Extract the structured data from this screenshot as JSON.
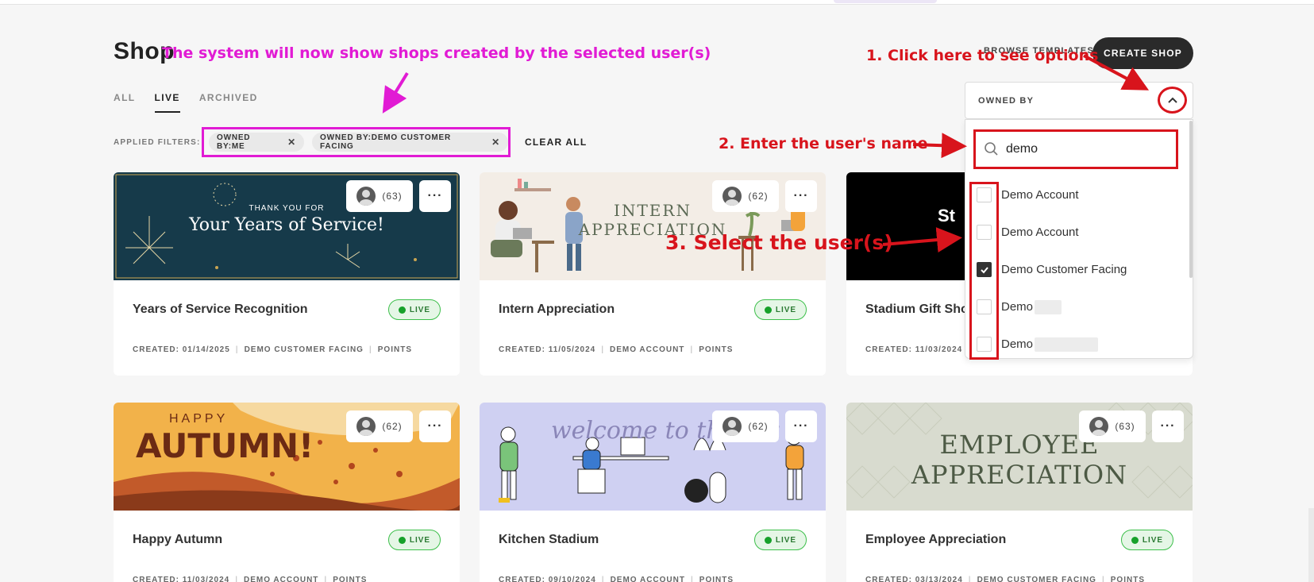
{
  "page": {
    "title": "Shop"
  },
  "tabs": [
    {
      "label": "ALL"
    },
    {
      "label": "LIVE"
    },
    {
      "label": "ARCHIVED"
    }
  ],
  "filters": {
    "label": "APPLIED FILTERS:",
    "chips": [
      "OWNED BY:ME",
      "OWNED BY:DEMO CUSTOMER FACING"
    ],
    "clear_label": "CLEAR ALL"
  },
  "toolbar": {
    "sort_label": "BROWSE TEMPLATES",
    "create_label": "CREATE SHOP",
    "owned_by_label": "OWNED BY"
  },
  "dropdown": {
    "search_value": "demo",
    "options": [
      {
        "label": "Demo Account",
        "checked": false
      },
      {
        "label": "Demo Account",
        "checked": false
      },
      {
        "label": "Demo Customer Facing",
        "checked": true
      },
      {
        "label": "Demo",
        "checked": false
      },
      {
        "label": "Demo",
        "checked": false
      }
    ]
  },
  "cards": [
    {
      "name": "Years of Service Recognition",
      "status": "LIVE",
      "count": "(63)",
      "image_line1": "THANK YOU FOR",
      "image_line2": "Your Years of Service!",
      "meta": [
        "CREATED: 01/14/2025",
        "DEMO CUSTOMER FACING",
        "POINTS"
      ]
    },
    {
      "name": "Intern Appreciation",
      "status": "LIVE",
      "count": "(62)",
      "image_line1": "INTERN",
      "image_line2": "APPRECIATION",
      "meta": [
        "CREATED: 11/05/2024",
        "DEMO ACCOUNT",
        "POINTS"
      ]
    },
    {
      "name": "Stadium Gift Sho",
      "status": "LIVE",
      "count": "",
      "image_line1": "St",
      "meta": [
        "CREATED: 11/03/2024"
      ]
    },
    {
      "name": "Happy Autumn",
      "status": "LIVE",
      "count": "(62)",
      "image_line1": "HAPPY",
      "image_line2": "AUTUMN!",
      "meta": [
        "CREATED: 11/03/2024",
        "DEMO ACCOUNT",
        "POINTS"
      ]
    },
    {
      "name": "Kitchen Stadium",
      "status": "LIVE",
      "count": "(62)",
      "image_line1": "welcome to the tea",
      "meta": [
        "CREATED: 09/10/2024",
        "DEMO ACCOUNT",
        "POINTS"
      ]
    },
    {
      "name": "Employee Appreciation",
      "status": "LIVE",
      "count": "(63)",
      "image_line1": "EMPLOYEE",
      "image_line2": "APPRECIATION",
      "meta": [
        "CREATED: 03/13/2024",
        "DEMO CUSTOMER FACING",
        "POINTS"
      ]
    }
  ],
  "annotations": {
    "top": "The system will now show shops created by the selected user(s)",
    "step1": "1. Click here to see options",
    "step2": "2. Enter the user's name",
    "step3": "3. Select the user(s)"
  },
  "colors": {
    "annotation_red": "#d8141c",
    "annotation_magenta": "#e11bd4",
    "live_green": "#17a12a",
    "button_dark": "#2a2a2a"
  }
}
